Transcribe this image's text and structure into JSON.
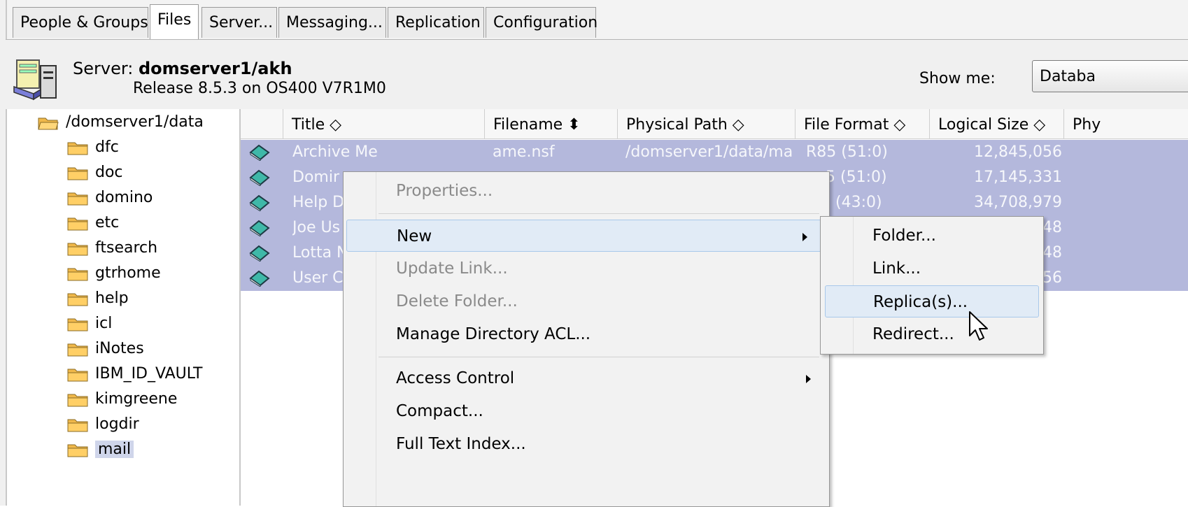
{
  "tabs": [
    {
      "label": "People & Groups"
    },
    {
      "label": "Files",
      "active": true
    },
    {
      "label": "Server..."
    },
    {
      "label": "Messaging..."
    },
    {
      "label": "Replication"
    },
    {
      "label": "Configuration"
    }
  ],
  "server": {
    "prefix": "Server: ",
    "name": "domserver1/akh",
    "release": "Release 8.5.3 on OS400 V7R1M0",
    "icon": "server-icon"
  },
  "show_me": {
    "label": "Show me:",
    "value": "Databa"
  },
  "tree": {
    "root": "/domserver1/data",
    "items": [
      "dfc",
      "doc",
      "domino",
      "etc",
      "ftsearch",
      "gtrhome",
      "help",
      "icl",
      "iNotes",
      "IBM_ID_VAULT",
      "kimgreene",
      "logdir",
      "mail"
    ],
    "selected": "mail"
  },
  "columns": [
    "Title ◇",
    "Filename ⬍",
    "Physical Path ◇",
    "File Format ◇",
    "Logical Size ◇",
    "Phy"
  ],
  "rows": [
    {
      "title": "Archive Me",
      "filename": "ame.nsf",
      "path": "/domserver1/data/ma",
      "format": "R85 (51:0)",
      "size": "12,845,056"
    },
    {
      "title": "Domir",
      "filename": "",
      "path": "",
      "format": "5 (51:0)",
      "size": "17,145,331"
    },
    {
      "title": "Help D",
      "filename": "",
      "path": "",
      "format": "(43:0)",
      "size": "34,708,979"
    },
    {
      "title": "Joe Us",
      "filename": "",
      "path": "",
      "format": "",
      "size": "48"
    },
    {
      "title": "Lotta N",
      "filename": "",
      "path": "",
      "format": "",
      "size": "48"
    },
    {
      "title": "User C",
      "filename": "",
      "path": "",
      "format": "",
      "size": "56"
    }
  ],
  "context_menu": {
    "properties": "Properties...",
    "new": "New",
    "update_link": "Update Link...",
    "delete_folder": "Delete Folder...",
    "manage_acl": "Manage Directory ACL...",
    "access_control": "Access Control",
    "compact": "Compact...",
    "full_text_index": "Full Text Index..."
  },
  "submenu": {
    "folder": "Folder...",
    "link": "Link...",
    "replicas": "Replica(s)...",
    "redirect": "Redirect..."
  },
  "colors": {
    "selection": "#b4b8dc",
    "menu_highlight": "#e1ebf6",
    "folder": "#f0b84a"
  }
}
